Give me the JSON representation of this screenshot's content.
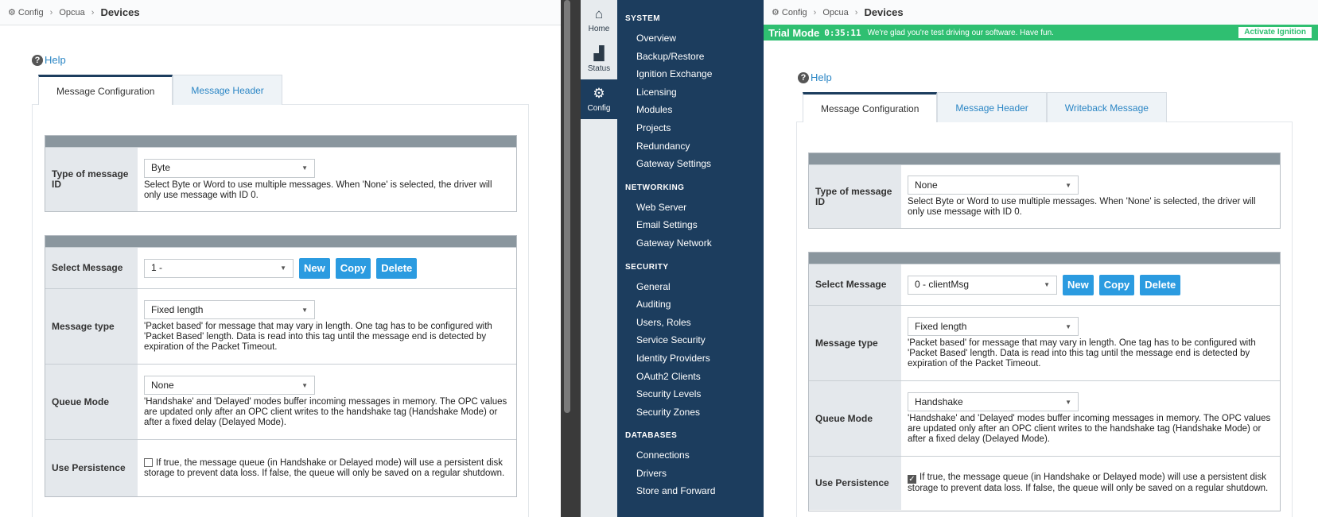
{
  "breadcrumb": {
    "config": "Config",
    "opcua": "Opcua",
    "current": "Devices"
  },
  "help_label": "Help",
  "tabs": {
    "message_configuration": "Message Configuration",
    "message_header": "Message Header",
    "writeback_message": "Writeback Message"
  },
  "labels": {
    "type_of_message_id_1": "Type of message",
    "type_of_message_id_2": "ID",
    "select_message": "Select Message",
    "message_type": "Message type",
    "queue_mode": "Queue Mode",
    "use_persistence": "Use Persistence"
  },
  "help_text": {
    "type_of_message_id": "Select Byte or Word to use multiple messages. When 'None' is selected, the driver will only use message with ID 0.",
    "message_type": "'Packet based' for message that may vary in length. One tag has to be configured with 'Packet Based' length. Data is read into this tag until the message end is detected by expiration of the Packet Timeout.",
    "queue_mode": "'Handshake' and 'Delayed' modes buffer incoming messages in memory. The OPC values are updated only after an OPC client writes to the handshake tag (Handshake Mode) or after a fixed delay (Delayed Mode).",
    "use_persistence": "If true, the message queue (in Handshake or Delayed mode) will use a persistent disk storage to prevent data loss. If false, the queue will only be saved on a regular shutdown."
  },
  "buttons": {
    "new": "New",
    "copy": "Copy",
    "delete": "Delete"
  },
  "left": {
    "type_of_message_id": "Byte",
    "select_message": "1 -",
    "message_type": "Fixed length",
    "queue_mode": "None",
    "use_persistence_checked": false
  },
  "right": {
    "type_of_message_id": "None",
    "select_message": "0 - clientMsg",
    "message_type": "Fixed length",
    "queue_mode": "Handshake",
    "use_persistence_checked": true
  },
  "rail": {
    "home": "Home",
    "status": "Status",
    "config": "Config"
  },
  "nav": {
    "system": "SYSTEM",
    "system_items": [
      "Overview",
      "Backup/Restore",
      "Ignition Exchange",
      "Licensing",
      "Modules",
      "Projects",
      "Redundancy",
      "Gateway Settings"
    ],
    "networking": "NETWORKING",
    "networking_items": [
      "Web Server",
      "Email Settings",
      "Gateway Network"
    ],
    "security": "SECURITY",
    "security_items": [
      "General",
      "Auditing",
      "Users, Roles",
      "Service Security",
      "Identity Providers",
      "OAuth2 Clients",
      "Security Levels",
      "Security Zones"
    ],
    "databases": "DATABASES",
    "databases_items": [
      "Connections",
      "Drivers",
      "Store and Forward"
    ]
  },
  "trial": {
    "mode": "Trial Mode",
    "timer": "0:35:11",
    "message": "We're glad you're test driving our software. Have fun.",
    "activate": "Activate Ignition"
  },
  "colors": {
    "nav_bg": "#1c3d5e",
    "trial_green": "#2fbf71",
    "button_blue": "#2b9be0",
    "link_blue": "#2b86c5"
  }
}
